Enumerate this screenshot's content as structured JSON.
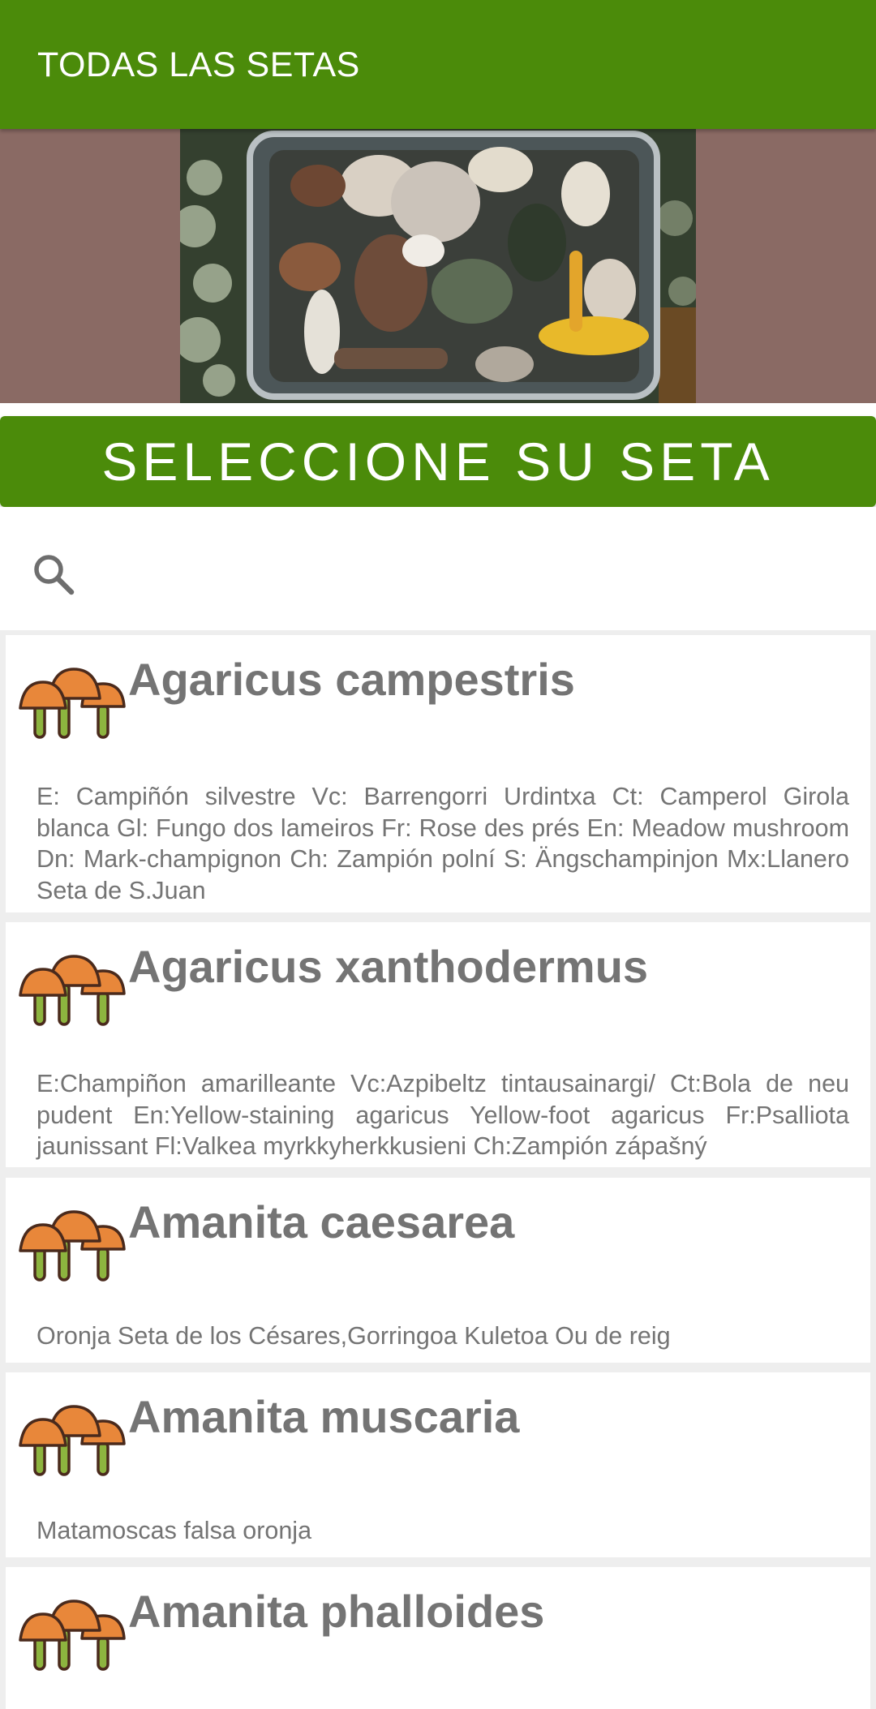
{
  "toolbar": {
    "title": "TODAS LAS SETAS"
  },
  "hero": {
    "image": "mushrooms-in-container-photo"
  },
  "banner": {
    "label": "SELECCIONE SU SETA"
  },
  "search": {
    "icon": "search-icon",
    "value": "",
    "placeholder": ""
  },
  "mushrooms": [
    {
      "name": "Agaricus campestris",
      "common_names": "E: Campiñón silvestre Vc: Barrengorri Urdintxa Ct: Camperol Girola blanca Gl: Fungo dos lameiros Fr: Rose des prés En: Meadow mushroom Dn: Mark-champignon Ch: Zampión polní S: Ängschampinjon Mx:Llanero Seta de S.Juan",
      "icon": "mushroom-icon"
    },
    {
      "name": "Agaricus xanthodermus",
      "common_names": "E:Champiñon amarilleante Vc:Azpibeltz tintausainargi/ Ct:Bola de neu pudent En:Yellow-staining agaricus Yellow-foot agaricus Fr:Psalliota jaunissant Fl:Valkea myrkkyherkkusieni Ch:Zampión zápašný",
      "icon": "mushroom-icon"
    },
    {
      "name": "Amanita caesarea",
      "common_names": "Oronja Seta de los Césares,Gorringoa Kuletoa Ou de reig",
      "icon": "mushroom-icon"
    },
    {
      "name": "Amanita muscaria",
      "common_names": "Matamoscas falsa oronja",
      "icon": "mushroom-icon"
    },
    {
      "name": "Amanita phalloides",
      "common_names": "",
      "icon": "mushroom-icon"
    }
  ],
  "colors": {
    "primary": "#4b8b0a",
    "hero_background": "#8a6a64",
    "list_background": "#eeeeee",
    "text_gray": "#747474",
    "mushroom_cap": "#e8873a",
    "mushroom_stem": "#8db43f"
  }
}
